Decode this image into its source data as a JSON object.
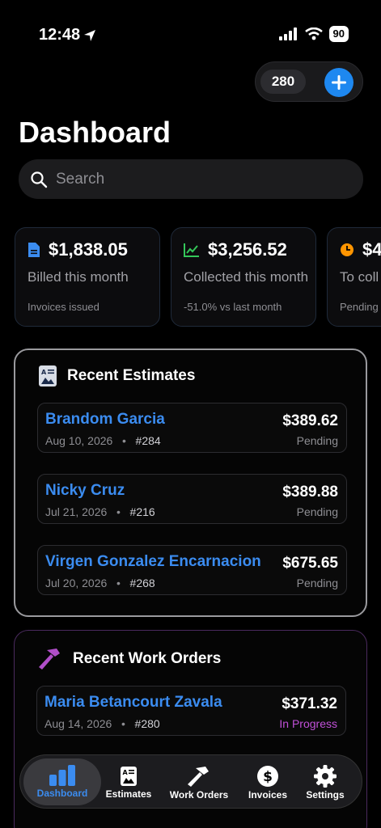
{
  "status_bar": {
    "time": "12:48",
    "battery": "90"
  },
  "header": {
    "count_badge": "280",
    "title": "Dashboard"
  },
  "search": {
    "placeholder": "Search"
  },
  "stats": [
    {
      "value": "$1,838.05",
      "label": "Billed this month",
      "sub": "Invoices issued",
      "icon": "document-icon",
      "color": "#3b8cf0"
    },
    {
      "value": "$3,256.52",
      "label": "Collected this month",
      "sub": "-51.0% vs last month",
      "icon": "chart-up-icon",
      "color": "#34c759"
    },
    {
      "value": "$4",
      "label": "To coll",
      "sub": "Pending",
      "icon": "clock-icon",
      "color": "#ff9500"
    }
  ],
  "recent_estimates": {
    "title": "Recent Estimates",
    "items": [
      {
        "name": "Brandom Garcia",
        "date": "Aug 10, 2026",
        "number": "#284",
        "amount": "$389.62",
        "status": "Pending"
      },
      {
        "name": "Nicky Cruz",
        "date": "Jul 21, 2026",
        "number": "#216",
        "amount": "$389.88",
        "status": "Pending"
      },
      {
        "name": "Virgen Gonzalez Encarnacion",
        "date": "Jul 20, 2026",
        "number": "#268",
        "amount": "$675.65",
        "status": "Pending"
      }
    ]
  },
  "recent_work_orders": {
    "title": "Recent Work Orders",
    "items": [
      {
        "name": "Maria Betancourt Zavala",
        "date": "Aug 14, 2026",
        "number": "#280",
        "amount": "$371.32",
        "status": "In Progress"
      }
    ]
  },
  "tabbar": {
    "dashboard": "Dashboard",
    "estimates": "Estimates",
    "work_orders": "Work Orders",
    "invoices": "Invoices",
    "settings": "Settings"
  },
  "colors": {
    "accent": "#3b8cf0",
    "in_progress": "#c050d8",
    "work_orders_icon": "#b04ec8"
  }
}
